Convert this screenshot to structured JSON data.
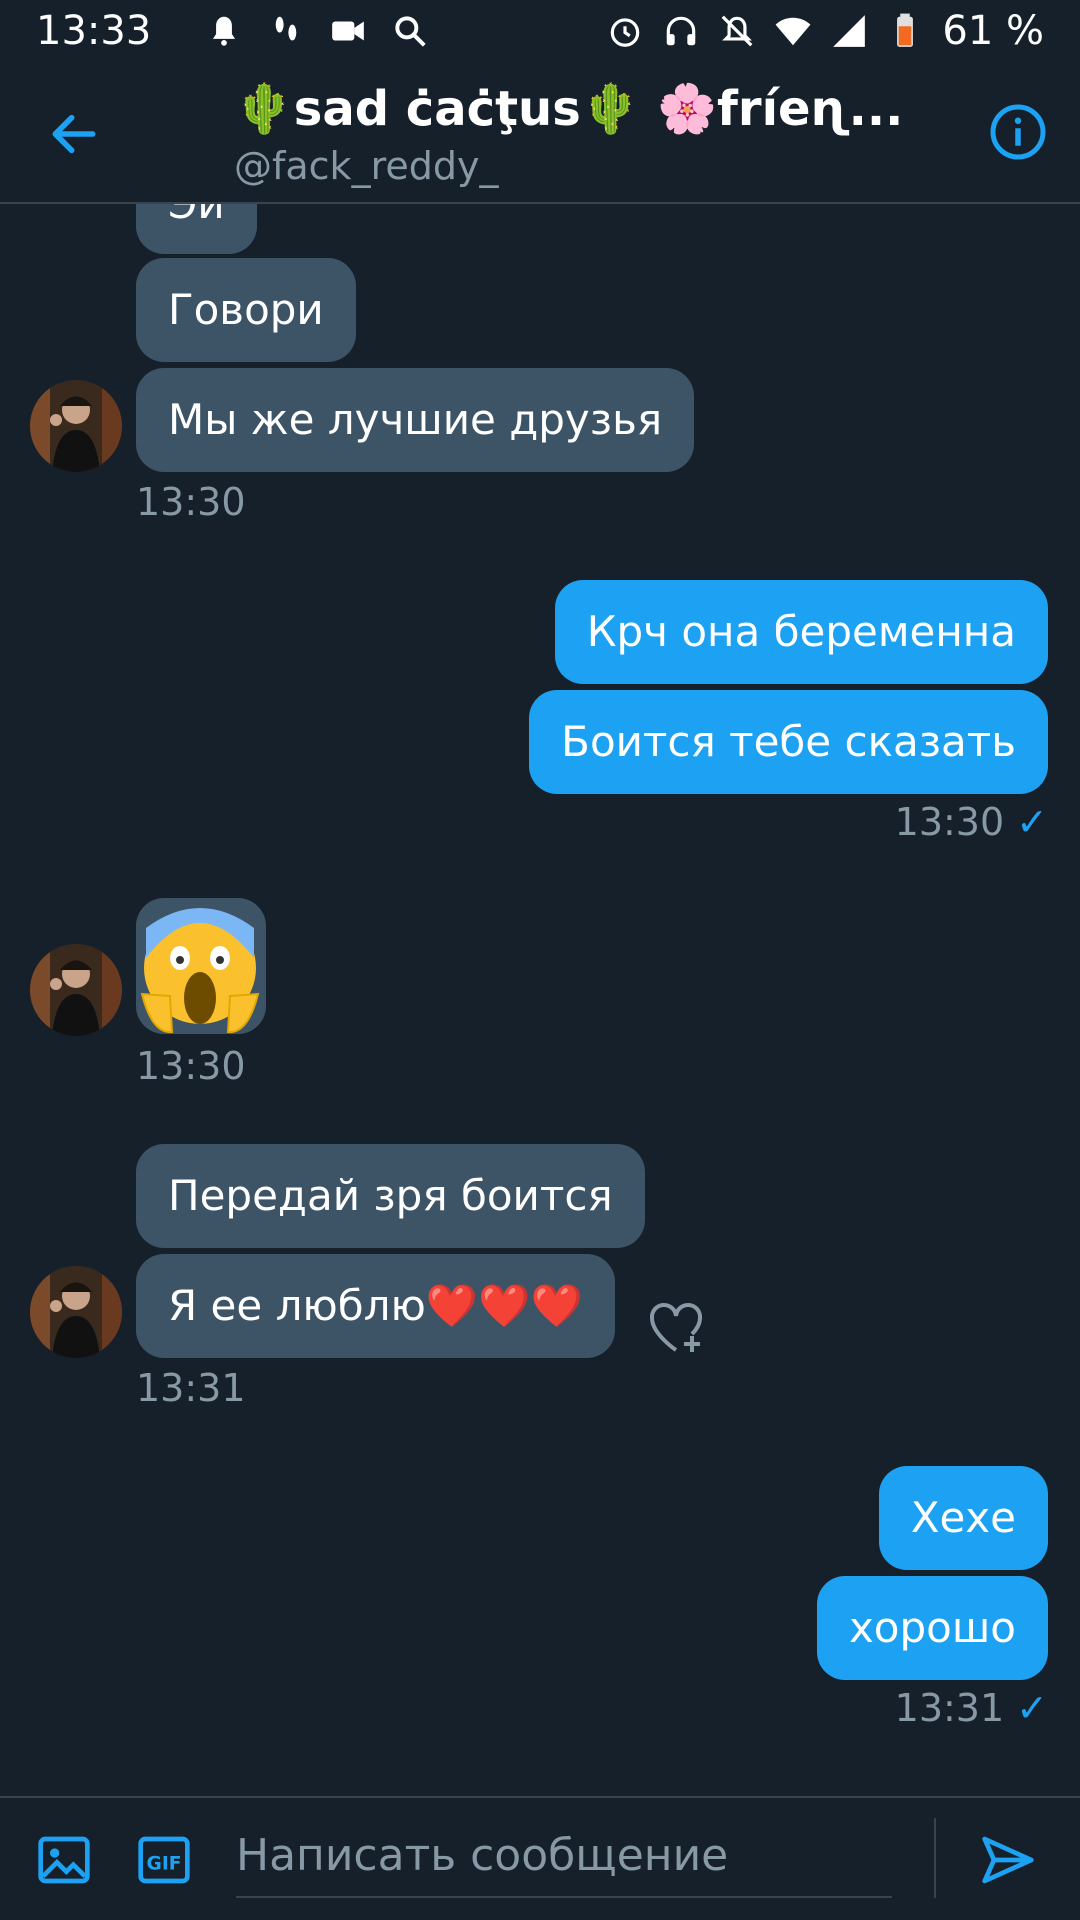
{
  "status_bar": {
    "time": "13:33",
    "battery": "61 %",
    "icons": [
      "notification-icon",
      "steps-icon",
      "video-icon",
      "search-icon",
      "alarm-icon",
      "headphones-icon",
      "mute-icon",
      "wifi-icon",
      "signal-icon",
      "battery-icon"
    ]
  },
  "header": {
    "title": "🌵sad ċaċţus🌵 🌸fríeɳ...",
    "handle": "@fack_reddy_",
    "colors": {
      "accent": "#1da1f2",
      "background": "#15202b"
    }
  },
  "messages": {
    "m0": {
      "text": "Эй"
    },
    "m1": {
      "text": "Говори"
    },
    "m2": {
      "text": "Мы же лучшие друзья"
    },
    "t1": "13:30",
    "m3": {
      "text": "Крч она беременна"
    },
    "m4": {
      "text": "Боится тебе сказать"
    },
    "t2": "13:30",
    "m5": {
      "emoji": "😱"
    },
    "t3": "13:30",
    "m6": {
      "text": "Передай зря боится"
    },
    "m7": {
      "text": "Я ее люблю❤️❤️❤️"
    },
    "t4": "13:31",
    "m8": {
      "text": "Хехе"
    },
    "m9": {
      "text": "хорошо"
    },
    "t5": "13:31"
  },
  "composer": {
    "placeholder": "Написать сообщение"
  }
}
